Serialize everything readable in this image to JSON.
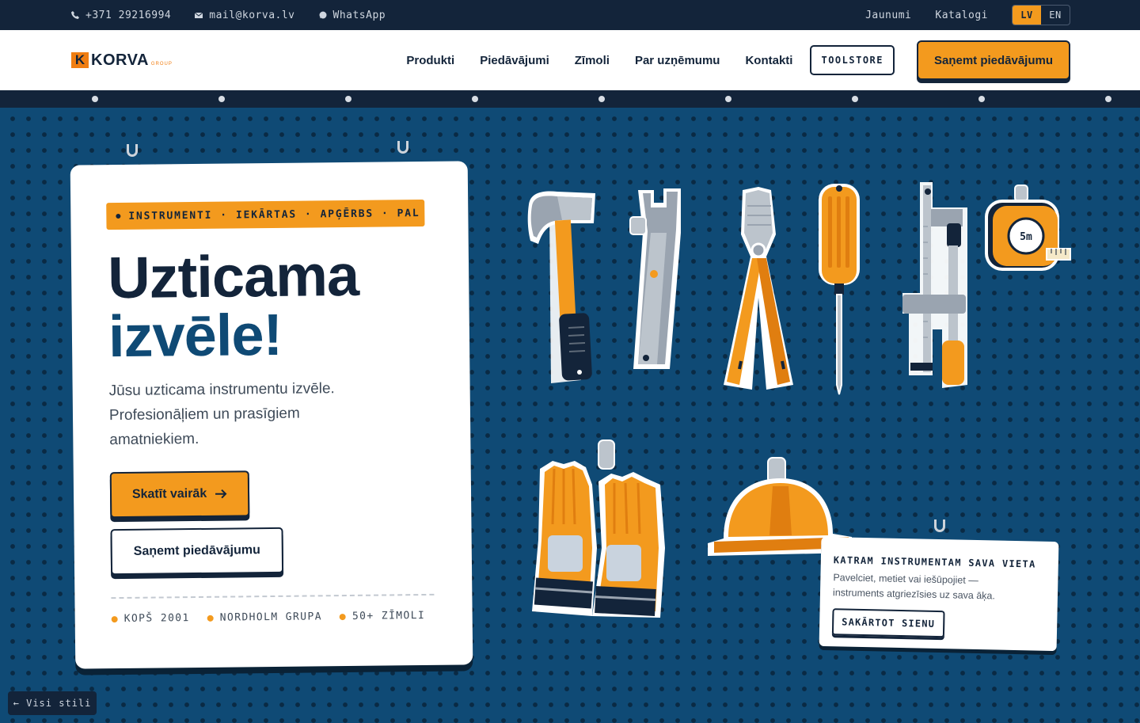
{
  "topbar": {
    "phone": "+371 29216994",
    "email": "mail@korva.lv",
    "whatsapp": "WhatsApp",
    "links": [
      "Jaunumi",
      "Katalogi"
    ],
    "lang": [
      "LV",
      "EN"
    ]
  },
  "nav": {
    "logo_mark": "K",
    "logo_text": "KORVA",
    "logo_sub": "GROUP",
    "items": [
      "Produkti",
      "Piedāvājumi",
      "Zīmoli",
      "Par uzņēmumu",
      "Kontakti"
    ],
    "toolstore": "TOOLSTORE",
    "cta": "Saņemt piedāvājumu"
  },
  "hero": {
    "tags": [
      "INSTRUMENTI",
      "·",
      "IEKĀRTAS",
      "·",
      "APĢĒRBS",
      "·",
      "PAL"
    ],
    "title_line1": "Uzticama",
    "title_line2": "izvēle!",
    "description": "Jūsu uzticama instrumentu izvēle. Profesionāļiem un prasīgiem amatniekiem.",
    "btn_primary": "Skatīt vairāk",
    "btn_secondary": "Saņemt piedāvājumu",
    "stats": [
      "KOPŠ 2001",
      "NORDHOLM GRUPA",
      "50+ ZĪMOLI"
    ]
  },
  "tools": {
    "tape_label": "5m"
  },
  "info": {
    "title": "KATRAM INSTRUMENTAM SAVA VIETA",
    "text": "Pavelciet, metiet vai iešūpojiet — instruments atgriezīsies uz sava āķa.",
    "button": "SAKĀRTOT SIENU"
  },
  "back": "← Visi stili",
  "colors": {
    "navy": "#13243a",
    "orange": "#f39a1e",
    "board": "#0f4a75"
  }
}
